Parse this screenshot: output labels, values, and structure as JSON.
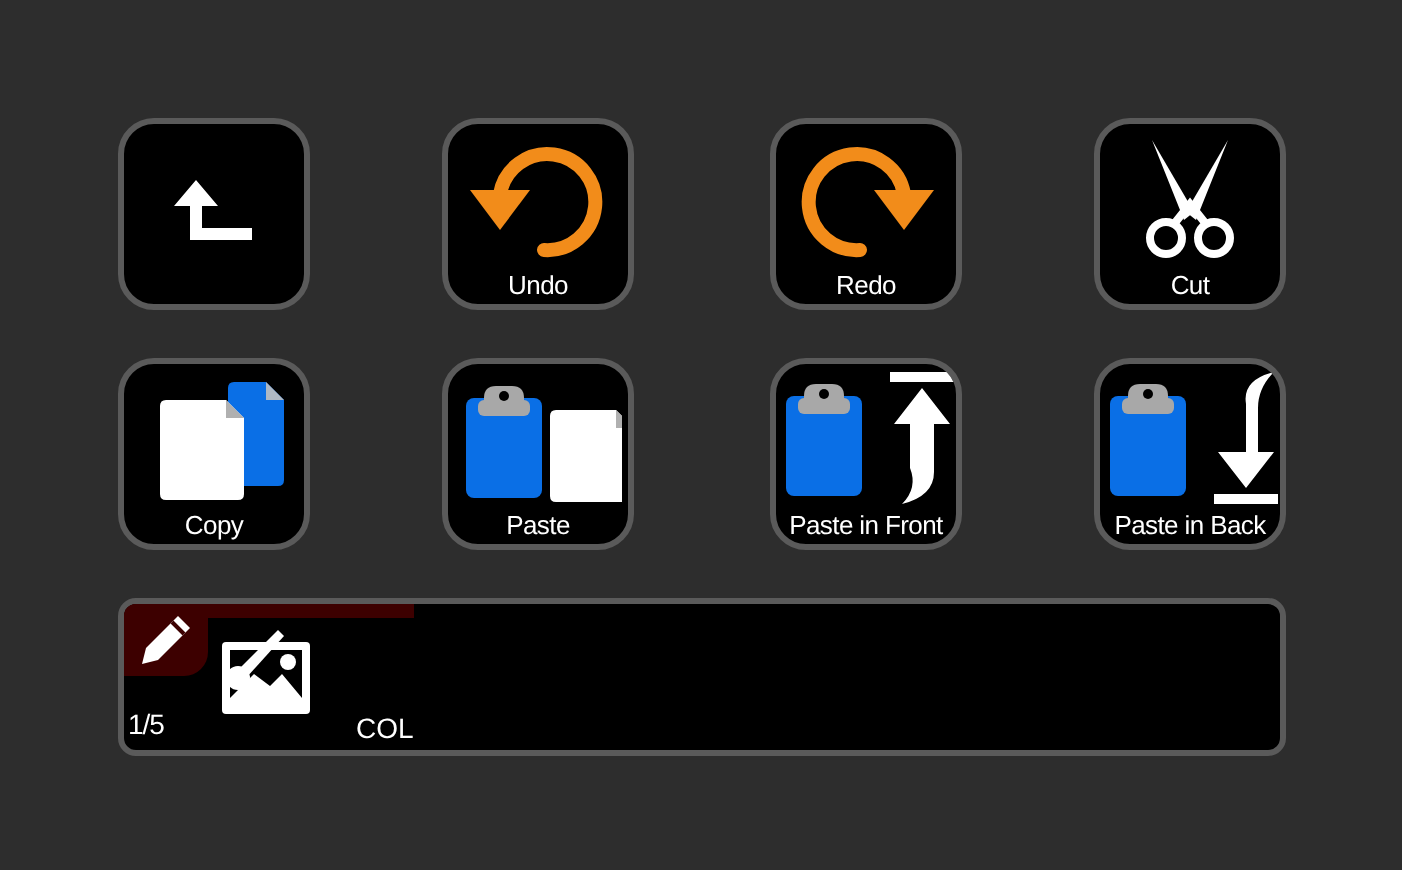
{
  "buttons": [
    {
      "kind": "back"
    },
    {
      "kind": "undo",
      "label": "Undo"
    },
    {
      "kind": "redo",
      "label": "Redo"
    },
    {
      "kind": "cut",
      "label": "Cut"
    },
    {
      "kind": "copy",
      "label": "Copy"
    },
    {
      "kind": "paste",
      "label": "Paste"
    },
    {
      "kind": "paste_front",
      "label": "Paste in Front"
    },
    {
      "kind": "paste_back",
      "label": "Paste in Back"
    }
  ],
  "panel": {
    "level": 0.25,
    "page": "1/5",
    "label": "COL"
  }
}
